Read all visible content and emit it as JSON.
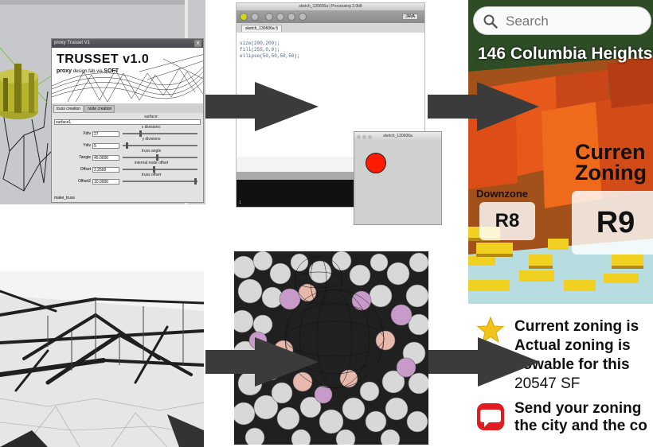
{
  "trusset": {
    "window_title": "proxy Trusset V1",
    "close_glyph": "x",
    "logo": "TRUSSET v1.0",
    "sub_prefix": "proxy",
    "sub_mid": " design.fab.via.",
    "sub_suffix": "SOFT",
    "tabs": [
      "truss creation",
      "node creation"
    ],
    "surface_label": "surface:",
    "surface_value": "surface1",
    "xdiv_header": "x divisions:",
    "xdiv_label": "Xdiv",
    "xdiv_value": "27",
    "ydiv_header": "y divisions",
    "ydiv_label": "Ydiv",
    "ydiv_value": "5",
    "angle_header": "truss angle",
    "angle_label": "Tangle",
    "angle_value": "45.0000",
    "offset_header": "internal node offset",
    "offset_label": "Offset",
    "offset_value": "2.2500",
    "offset2_header": "truss offset",
    "offset2_label": "Offset2",
    "offset2_value": "10.0000",
    "footer": "make_truss"
  },
  "processing": {
    "window_title": "sketch_130606a | Processing 2.0b8",
    "mode": "JAVA",
    "tab": "sketch_130606a §",
    "code": [
      "size(200,200);",
      "fill(255,0,0);",
      "ellipse(50,50,50,50);"
    ],
    "sketch_title": "sketch_130606a",
    "console_line": "1"
  },
  "zoning": {
    "search_placeholder": "Search",
    "address": "146 Columbia Heights",
    "current_line1": "Curren",
    "current_line2": "Zoning",
    "downzone": "Downzone",
    "r8": "R8",
    "r9": "R9",
    "info_lines": [
      "Current zoning is",
      "Actual zoning is",
      "llowable for this",
      "20547 SF"
    ],
    "send_lines": [
      "Send your zoning",
      "the city and the co"
    ],
    "colors": {
      "accent_red": "#e01b22",
      "star_yellow": "#f2c318",
      "arrow": "#3b3b3b"
    }
  }
}
